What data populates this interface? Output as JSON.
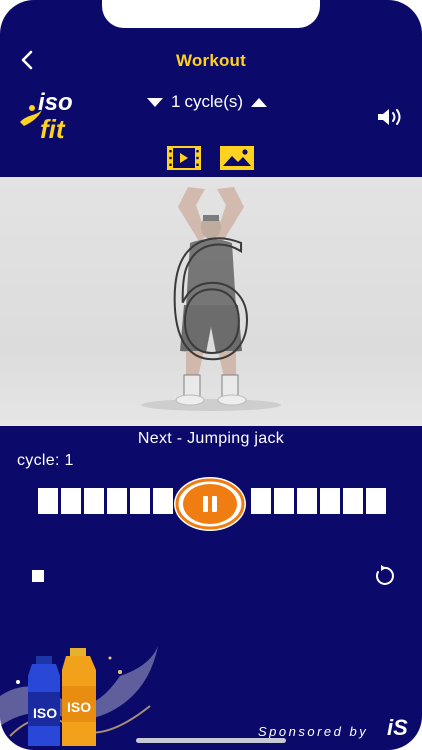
{
  "header": {
    "title": "Workout",
    "cycle_value": "1",
    "cycle_unit": "cycle(s)"
  },
  "logo": {
    "line1": "iso",
    "line2": "fit"
  },
  "media_toggle": {
    "selected": "image"
  },
  "player": {
    "countdown": "6",
    "exercise_shown": "Jumping jack"
  },
  "status": {
    "next_label": "Next - Jumping jack",
    "cycle_label": "cycle: 1"
  },
  "progress": {
    "segments_total": 12,
    "segments_done": 0
  },
  "footer": {
    "sponsor_text": "Sponsored by",
    "sponsor_logo_text": "iS"
  },
  "colors": {
    "background": "#0b0a6b",
    "title": "#ffd21f",
    "accent_orange": "#f07d12",
    "white": "#ffffff"
  },
  "icons": {
    "back": "chevron-left-icon",
    "decrease": "triangle-down-icon",
    "increase": "triangle-up-icon",
    "sound": "speaker-icon",
    "video": "film-icon",
    "image": "image-icon",
    "pause": "pause-icon",
    "stop": "stop-icon",
    "reset": "refresh-icon"
  }
}
